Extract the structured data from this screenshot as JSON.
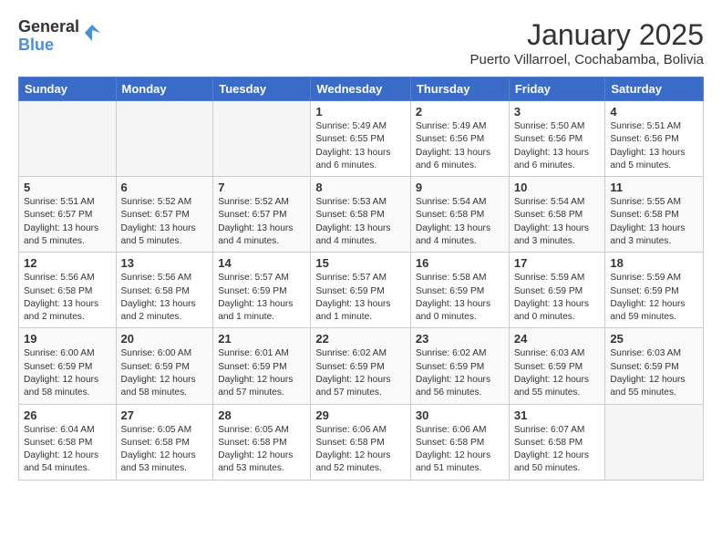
{
  "logo": {
    "general": "General",
    "blue": "Blue"
  },
  "title": "January 2025",
  "location": "Puerto Villarroel, Cochabamba, Bolivia",
  "days_of_week": [
    "Sunday",
    "Monday",
    "Tuesday",
    "Wednesday",
    "Thursday",
    "Friday",
    "Saturday"
  ],
  "weeks": [
    [
      {
        "day": "",
        "info": ""
      },
      {
        "day": "",
        "info": ""
      },
      {
        "day": "",
        "info": ""
      },
      {
        "day": "1",
        "info": "Sunrise: 5:49 AM\nSunset: 6:55 PM\nDaylight: 13 hours\nand 6 minutes."
      },
      {
        "day": "2",
        "info": "Sunrise: 5:49 AM\nSunset: 6:56 PM\nDaylight: 13 hours\nand 6 minutes."
      },
      {
        "day": "3",
        "info": "Sunrise: 5:50 AM\nSunset: 6:56 PM\nDaylight: 13 hours\nand 6 minutes."
      },
      {
        "day": "4",
        "info": "Sunrise: 5:51 AM\nSunset: 6:56 PM\nDaylight: 13 hours\nand 5 minutes."
      }
    ],
    [
      {
        "day": "5",
        "info": "Sunrise: 5:51 AM\nSunset: 6:57 PM\nDaylight: 13 hours\nand 5 minutes."
      },
      {
        "day": "6",
        "info": "Sunrise: 5:52 AM\nSunset: 6:57 PM\nDaylight: 13 hours\nand 5 minutes."
      },
      {
        "day": "7",
        "info": "Sunrise: 5:52 AM\nSunset: 6:57 PM\nDaylight: 13 hours\nand 4 minutes."
      },
      {
        "day": "8",
        "info": "Sunrise: 5:53 AM\nSunset: 6:58 PM\nDaylight: 13 hours\nand 4 minutes."
      },
      {
        "day": "9",
        "info": "Sunrise: 5:54 AM\nSunset: 6:58 PM\nDaylight: 13 hours\nand 4 minutes."
      },
      {
        "day": "10",
        "info": "Sunrise: 5:54 AM\nSunset: 6:58 PM\nDaylight: 13 hours\nand 3 minutes."
      },
      {
        "day": "11",
        "info": "Sunrise: 5:55 AM\nSunset: 6:58 PM\nDaylight: 13 hours\nand 3 minutes."
      }
    ],
    [
      {
        "day": "12",
        "info": "Sunrise: 5:56 AM\nSunset: 6:58 PM\nDaylight: 13 hours\nand 2 minutes."
      },
      {
        "day": "13",
        "info": "Sunrise: 5:56 AM\nSunset: 6:58 PM\nDaylight: 13 hours\nand 2 minutes."
      },
      {
        "day": "14",
        "info": "Sunrise: 5:57 AM\nSunset: 6:59 PM\nDaylight: 13 hours\nand 1 minute."
      },
      {
        "day": "15",
        "info": "Sunrise: 5:57 AM\nSunset: 6:59 PM\nDaylight: 13 hours\nand 1 minute."
      },
      {
        "day": "16",
        "info": "Sunrise: 5:58 AM\nSunset: 6:59 PM\nDaylight: 13 hours\nand 0 minutes."
      },
      {
        "day": "17",
        "info": "Sunrise: 5:59 AM\nSunset: 6:59 PM\nDaylight: 13 hours\nand 0 minutes."
      },
      {
        "day": "18",
        "info": "Sunrise: 5:59 AM\nSunset: 6:59 PM\nDaylight: 12 hours\nand 59 minutes."
      }
    ],
    [
      {
        "day": "19",
        "info": "Sunrise: 6:00 AM\nSunset: 6:59 PM\nDaylight: 12 hours\nand 58 minutes."
      },
      {
        "day": "20",
        "info": "Sunrise: 6:00 AM\nSunset: 6:59 PM\nDaylight: 12 hours\nand 58 minutes."
      },
      {
        "day": "21",
        "info": "Sunrise: 6:01 AM\nSunset: 6:59 PM\nDaylight: 12 hours\nand 57 minutes."
      },
      {
        "day": "22",
        "info": "Sunrise: 6:02 AM\nSunset: 6:59 PM\nDaylight: 12 hours\nand 57 minutes."
      },
      {
        "day": "23",
        "info": "Sunrise: 6:02 AM\nSunset: 6:59 PM\nDaylight: 12 hours\nand 56 minutes."
      },
      {
        "day": "24",
        "info": "Sunrise: 6:03 AM\nSunset: 6:59 PM\nDaylight: 12 hours\nand 55 minutes."
      },
      {
        "day": "25",
        "info": "Sunrise: 6:03 AM\nSunset: 6:59 PM\nDaylight: 12 hours\nand 55 minutes."
      }
    ],
    [
      {
        "day": "26",
        "info": "Sunrise: 6:04 AM\nSunset: 6:58 PM\nDaylight: 12 hours\nand 54 minutes."
      },
      {
        "day": "27",
        "info": "Sunrise: 6:05 AM\nSunset: 6:58 PM\nDaylight: 12 hours\nand 53 minutes."
      },
      {
        "day": "28",
        "info": "Sunrise: 6:05 AM\nSunset: 6:58 PM\nDaylight: 12 hours\nand 53 minutes."
      },
      {
        "day": "29",
        "info": "Sunrise: 6:06 AM\nSunset: 6:58 PM\nDaylight: 12 hours\nand 52 minutes."
      },
      {
        "day": "30",
        "info": "Sunrise: 6:06 AM\nSunset: 6:58 PM\nDaylight: 12 hours\nand 51 minutes."
      },
      {
        "day": "31",
        "info": "Sunrise: 6:07 AM\nSunset: 6:58 PM\nDaylight: 12 hours\nand 50 minutes."
      },
      {
        "day": "",
        "info": ""
      }
    ]
  ]
}
